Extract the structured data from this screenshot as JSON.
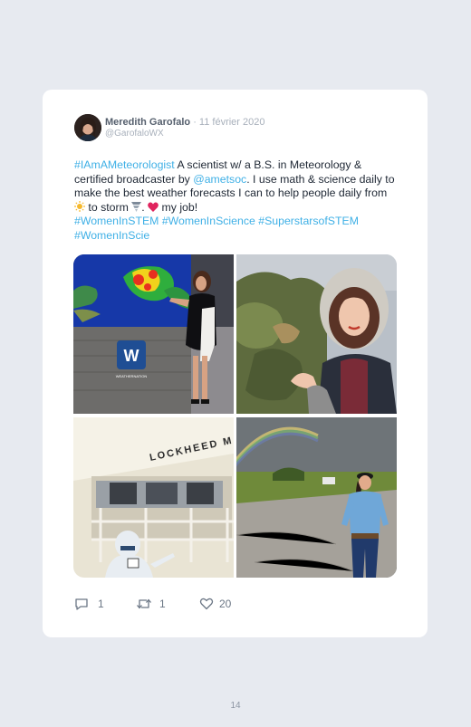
{
  "tweet": {
    "author_name": "Meredith Garofalo",
    "separator": "·",
    "date": "11 février 2020",
    "handle": "@GarofaloWX",
    "text": {
      "hashtag_1": "#IAmAMeteorologist",
      "part_1": " A scientist w/ a B.S. in Meteorology & certified broadcaster by ",
      "mention_1": "@ametsoc",
      "part_2": ". I use math & science daily to make the best weather forecasts I can to help people daily from ",
      "part_3": " to storm ",
      "part_4": ". ",
      "part_5": " my job!",
      "hashtag_2": "#WomenInSTEM",
      "hashtag_3": "#WomenInScience",
      "hashtag_4": "#SuperstarsofSTEM",
      "hashtag_5": "#WomenInScie"
    },
    "photos": [
      {
        "id": "photo-1",
        "logo_letter": "W",
        "logo_caption": "WEATHERNATION"
      },
      {
        "id": "photo-2"
      },
      {
        "id": "photo-3",
        "sign_text": "LOCKHEED MA"
      },
      {
        "id": "photo-4"
      }
    ],
    "stats": {
      "replies": "1",
      "retweets": "1",
      "likes": "20"
    },
    "colors": {
      "link": "#3fb0e6",
      "heart": "#e0245e"
    }
  },
  "page": {
    "number": "14"
  }
}
